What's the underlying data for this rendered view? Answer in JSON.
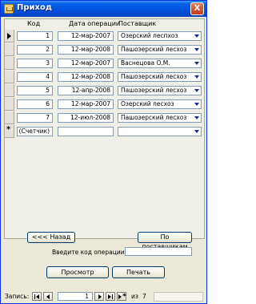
{
  "window": {
    "title": "Приход",
    "close_glyph": "X"
  },
  "datasheet": {
    "columns": [
      "Код",
      "Дата операции",
      "Поставщик"
    ],
    "rows": [
      {
        "code": "1",
        "date": "12-мар-2007",
        "supplier": "Озерский леспхоз"
      },
      {
        "code": "2",
        "date": "12-мар-2008",
        "supplier": "Пашозерский лесхоз"
      },
      {
        "code": "3",
        "date": "12-мар-2007",
        "supplier": "Васнецова О.М."
      },
      {
        "code": "4",
        "date": "12-мар-2008",
        "supplier": "Пашозерский лесхоз"
      },
      {
        "code": "5",
        "date": "12-апр-2008",
        "supplier": "Пашозерский лесхоз"
      },
      {
        "code": "6",
        "date": "12-мар-2007",
        "supplier": "Озерский лесхоз"
      },
      {
        "code": "7",
        "date": "12-июл-2008",
        "supplier": "Пашозерский лесхоз"
      }
    ],
    "new_row": {
      "code": "(Счетчик)",
      "date": "",
      "supplier": ""
    }
  },
  "form": {
    "back_label": "<<< Назад",
    "by_supplier_label": "По поставщикам",
    "enter_code_label": "Введите код операции:",
    "code_value": "",
    "preview_label": "Просмотр",
    "print_label": "Печать"
  },
  "navigation": {
    "label": "Запись:",
    "current": "1",
    "of_label": "из",
    "total": "7"
  }
}
